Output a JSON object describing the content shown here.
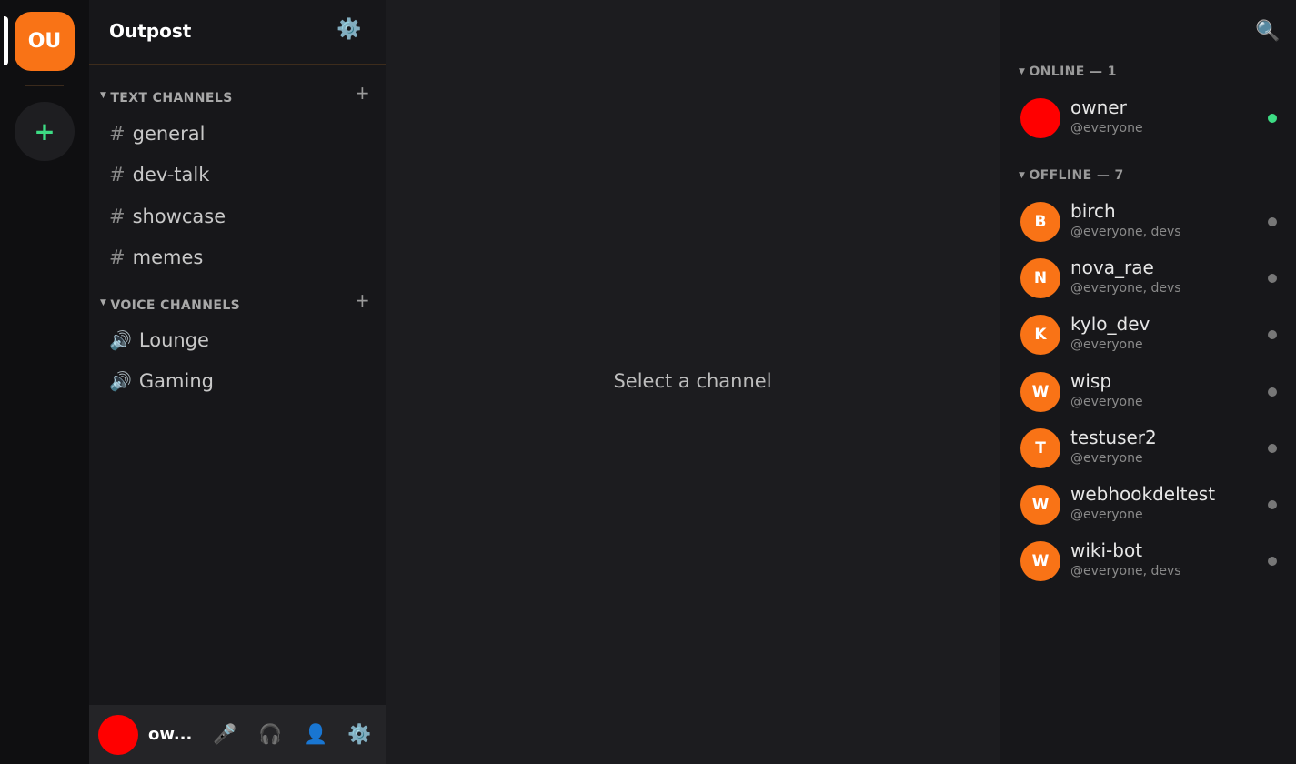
{
  "rail": {
    "server": {
      "initials": "OU"
    },
    "add_server": {
      "label": "+"
    }
  },
  "sidebar": {
    "server_name": "Outpost",
    "text_category": {
      "label": "TEXT CHANNELS",
      "add": "+"
    },
    "text_channels": [
      {
        "name": "general"
      },
      {
        "name": "dev-talk"
      },
      {
        "name": "showcase"
      },
      {
        "name": "memes"
      }
    ],
    "voice_category": {
      "label": "VOICE CHANNELS",
      "add": "+"
    },
    "voice_channels": [
      {
        "name": "Lounge"
      },
      {
        "name": "Gaming"
      }
    ],
    "user_bar": {
      "username": "ow..."
    }
  },
  "main": {
    "placeholder": "Select a channel"
  },
  "members": {
    "online_header": "ONLINE — 1",
    "offline_header": "OFFLINE — 7",
    "online": [
      {
        "name": "owner",
        "roles": "@everyone",
        "initial": ""
      }
    ],
    "offline": [
      {
        "name": "birch",
        "roles": "@everyone, devs",
        "initial": "B"
      },
      {
        "name": "nova_rae",
        "roles": "@everyone, devs",
        "initial": "N"
      },
      {
        "name": "kylo_dev",
        "roles": "@everyone",
        "initial": "K"
      },
      {
        "name": "wisp",
        "roles": "@everyone",
        "initial": "W"
      },
      {
        "name": "testuser2",
        "roles": "@everyone",
        "initial": "T"
      },
      {
        "name": "webhookdeltest",
        "roles": "@everyone",
        "initial": "W"
      },
      {
        "name": "wiki-bot",
        "roles": "@everyone, devs",
        "initial": "W"
      }
    ]
  },
  "colors": {
    "accent": "#f97316",
    "owner_avatar": "#ff0000",
    "online": "#3ddc84",
    "offline": "#777777"
  }
}
